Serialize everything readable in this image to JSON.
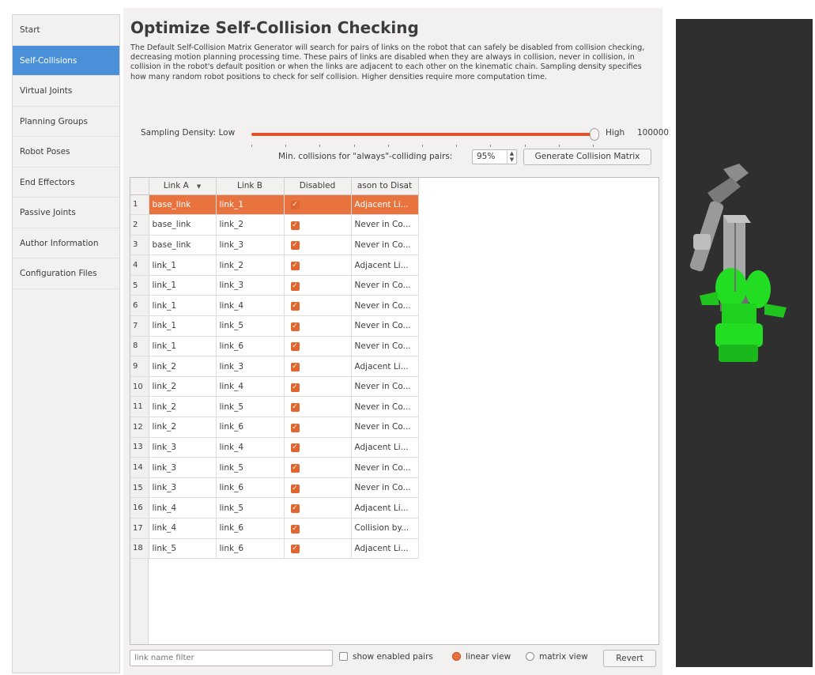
{
  "sidebar": {
    "items": [
      {
        "label": "Start"
      },
      {
        "label": "Self-Collisions"
      },
      {
        "label": "Virtual Joints"
      },
      {
        "label": "Planning Groups"
      },
      {
        "label": "Robot Poses"
      },
      {
        "label": "End Effectors"
      },
      {
        "label": "Passive Joints"
      },
      {
        "label": "Author Information"
      },
      {
        "label": "Configuration Files"
      }
    ],
    "active_index": 1
  },
  "main": {
    "title": "Optimize Self-Collision Checking",
    "description": "The Default Self-Collision Matrix Generator will search for pairs of links on the robot that can safely be disabled from collision checking, decreasing motion planning processing time. These pairs of links are disabled when they are always in collision, never in collision, in collision in the robot's default position or when the links are adjacent to each other on the kinematic chain. Sampling density specifies how many random robot positions to check for self collision. Higher densities require more computation time.",
    "density": {
      "label": "Sampling Density: Low",
      "high_label": "High",
      "value": "100000",
      "slider_fraction": 1.0
    },
    "min_collisions": {
      "label": "Min. collisions for \"always\"-colliding pairs:",
      "value": "95%",
      "button_label": "Generate Collision Matrix"
    },
    "table": {
      "headers": [
        "Link A",
        "Link B",
        "Disabled",
        "ason to Disat"
      ],
      "selected_row": 0,
      "rows": [
        {
          "num": "1",
          "a": "base_link",
          "b": "link_1",
          "reason": "Adjacent Li..."
        },
        {
          "num": "2",
          "a": "base_link",
          "b": "link_2",
          "reason": "Never in Co..."
        },
        {
          "num": "3",
          "a": "base_link",
          "b": "link_3",
          "reason": "Never in Co..."
        },
        {
          "num": "4",
          "a": "link_1",
          "b": "link_2",
          "reason": "Adjacent Li..."
        },
        {
          "num": "5",
          "a": "link_1",
          "b": "link_3",
          "reason": "Never in Co..."
        },
        {
          "num": "6",
          "a": "link_1",
          "b": "link_4",
          "reason": "Never in Co..."
        },
        {
          "num": "7",
          "a": "link_1",
          "b": "link_5",
          "reason": "Never in Co..."
        },
        {
          "num": "8",
          "a": "link_1",
          "b": "link_6",
          "reason": "Never in Co..."
        },
        {
          "num": "9",
          "a": "link_2",
          "b": "link_3",
          "reason": "Adjacent Li..."
        },
        {
          "num": "10",
          "a": "link_2",
          "b": "link_4",
          "reason": "Never in Co..."
        },
        {
          "num": "11",
          "a": "link_2",
          "b": "link_5",
          "reason": "Never in Co..."
        },
        {
          "num": "12",
          "a": "link_2",
          "b": "link_6",
          "reason": "Never in Co..."
        },
        {
          "num": "13",
          "a": "link_3",
          "b": "link_4",
          "reason": "Adjacent Li..."
        },
        {
          "num": "14",
          "a": "link_3",
          "b": "link_5",
          "reason": "Never in Co..."
        },
        {
          "num": "15",
          "a": "link_3",
          "b": "link_6",
          "reason": "Never in Co..."
        },
        {
          "num": "16",
          "a": "link_4",
          "b": "link_5",
          "reason": "Adjacent Li..."
        },
        {
          "num": "17",
          "a": "link_4",
          "b": "link_6",
          "reason": "Collision by..."
        },
        {
          "num": "18",
          "a": "link_5",
          "b": "link_6",
          "reason": "Adjacent Li..."
        }
      ]
    },
    "bottom": {
      "filter_placeholder": "link name filter",
      "show_enabled_label": "show enabled pairs",
      "linear_view_label": "linear view",
      "matrix_view_label": "matrix view",
      "revert_label": "Revert"
    }
  },
  "colors": {
    "accent": "#e8733e",
    "sidebar_active": "#4a90d9",
    "robot_green": "#22dd22",
    "viewer_bg": "#2f2f30"
  }
}
